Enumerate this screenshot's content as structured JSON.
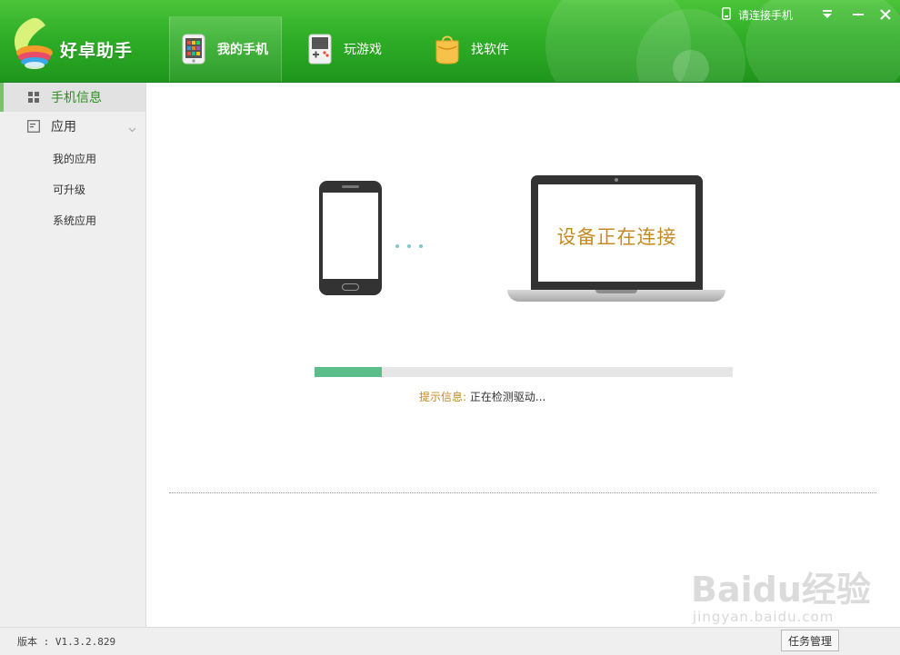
{
  "app": {
    "name": "好卓助手"
  },
  "header": {
    "tabs": [
      {
        "label": "我的手机",
        "icon": "phone-icon",
        "active": true
      },
      {
        "label": "玩游戏",
        "icon": "gamepad-icon",
        "active": false
      },
      {
        "label": "找软件",
        "icon": "shopping-bag-icon",
        "active": false
      }
    ],
    "connection_status": "请连接手机",
    "window_controls": {
      "menu": "⏷",
      "minimize": "—",
      "close": "✕"
    }
  },
  "sidebar": {
    "items": [
      {
        "label": "手机信息",
        "icon": "grid-icon",
        "active": true
      },
      {
        "label": "应用",
        "icon": "app-list-icon",
        "active": false,
        "expanded": true
      }
    ],
    "sub_items": [
      "我的应用",
      "可升级",
      "系统应用"
    ]
  },
  "main": {
    "laptop_screen_text": "设备正在连接",
    "progress": 0.16,
    "hint_label": "提示信息:",
    "hint_value": "正在检测驱动..."
  },
  "statusbar": {
    "version": "版本 : V1.3.2.829",
    "task_button": "任务管理"
  },
  "watermark": {
    "main": "Baidu经验",
    "sub": "jingyan.baidu.com"
  },
  "colors": {
    "header_green": "#2fae27",
    "accent_green": "#2d8f21",
    "progress_fill": "#5bbd8a",
    "hint_orange": "#c68a24"
  }
}
